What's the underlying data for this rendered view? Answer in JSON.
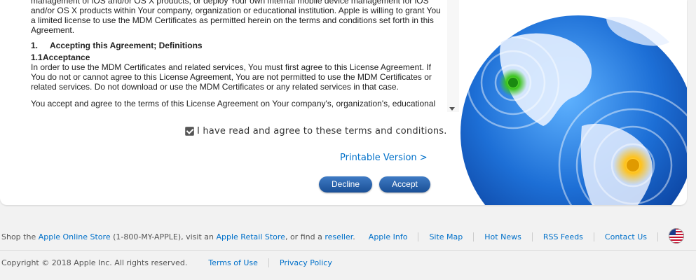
{
  "license": {
    "intro_lines": [
      "management of iOS and/or OS X products, or deploy Your own internal mobile device management for iOS",
      "and/or OS X products within Your company, organization or educational institution. Apple is willing to grant You",
      "a limited license to use the MDM Certificates as permitted herein on the terms and conditions set forth in this",
      "Agreement."
    ],
    "section_number": "1.",
    "section_title": "Accepting this Agreement; Definitions",
    "subsection_number": "1.1",
    "subsection_title": "Acceptance",
    "para1_lines": [
      "In order to use the MDM Certificates and related services, You must first agree to this License Agreement. If",
      "You do not or cannot agree to this License Agreement, You are not permitted to use the MDM Certificates or",
      "related services. Do not download or use the MDM Certificates or any related services in that case."
    ],
    "para2_line": "You accept and agree to the terms of this License Agreement on Your company's, organization's, educational"
  },
  "agree_label": "I have read and agree to these terms and conditions.",
  "printable_link": "Printable Version >",
  "buttons": {
    "decline": "Decline",
    "accept": "Accept"
  },
  "footer": {
    "shop_prefix": "Shop the ",
    "online_store": "Apple Online Store",
    "shop_middle": " (1-800-MY-APPLE), visit an ",
    "retail_store": "Apple Retail Store",
    "shop_or": ", or find a ",
    "reseller": "reseller",
    "shop_end": ".",
    "nav": [
      "Apple Info",
      "Site Map",
      "Hot News",
      "RSS Feeds",
      "Contact Us"
    ],
    "copyright": "Copyright © 2018 Apple Inc. All rights reserved.",
    "terms": "Terms of Use",
    "privacy": "Privacy Policy"
  },
  "icons": {
    "globe": "globe-illustration",
    "flag": "us-flag-icon"
  }
}
